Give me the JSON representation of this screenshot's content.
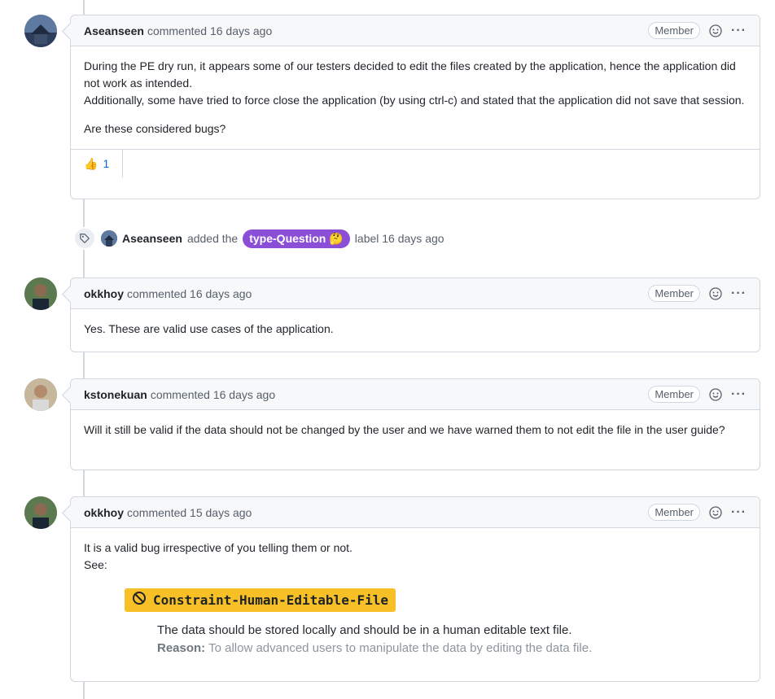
{
  "comments": [
    {
      "author": "Aseanseen",
      "meta": "commented 16 days ago",
      "role": "Member",
      "paragraphs": [
        "During the PE dry run, it appears some of our testers decided to edit the files created by the application, hence the application did not work as intended.",
        "Additionally, some have tried to force close the application (by using ctrl-c) and stated that the application did not save that session.",
        "Are these considered bugs?"
      ],
      "reaction": {
        "emoji": "👍",
        "count": "1"
      }
    },
    {
      "author": "okkhoy",
      "meta": "commented 16 days ago",
      "role": "Member",
      "paragraphs": [
        "Yes. These are valid use cases of the application."
      ]
    },
    {
      "author": "kstonekuan",
      "meta": "commented 16 days ago",
      "role": "Member",
      "paragraphs": [
        "Will it still be valid if the data should not be changed by the user and we have warned them to not edit the file in the user guide?"
      ]
    },
    {
      "author": "okkhoy",
      "meta": "commented 15 days ago",
      "role": "Member",
      "paragraphs": [
        "It is a valid bug irrespective of you telling them or not.",
        "See:"
      ],
      "constraint": {
        "title": "Constraint-Human-Editable-File",
        "text": "The data should be stored locally and should be in a human editable text file.",
        "reason_label": "Reason:",
        "reason_text": "To allow advanced users to manipulate the data by editing the data file."
      }
    }
  ],
  "label_event": {
    "actor": "Aseanseen",
    "action": "added the",
    "label": "type-Question",
    "label_emoji": "🤔",
    "label_color": "#8a4fd6",
    "suffix": "label 16 days ago"
  },
  "icons": [
    "tag-icon",
    "smiley-icon",
    "kebab-icon",
    "block-icon"
  ]
}
